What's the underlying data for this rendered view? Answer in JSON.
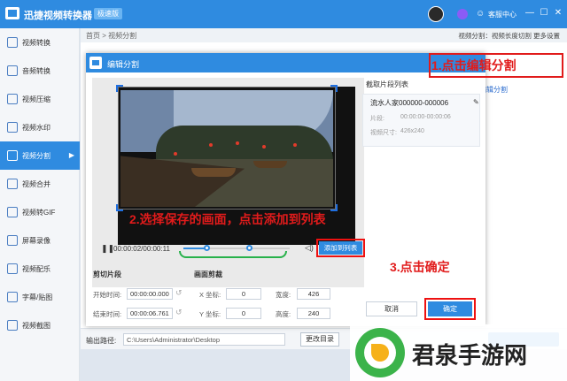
{
  "app": {
    "title": "迅捷视频转换器",
    "edition": "极速版",
    "customer_service": "客服中心",
    "window_buttons": [
      "—",
      "☐",
      "✕"
    ]
  },
  "sidebar": {
    "items": [
      {
        "label": "视频转换",
        "icon": "video-convert-icon"
      },
      {
        "label": "音频转换",
        "icon": "audio-convert-icon"
      },
      {
        "label": "视频压缩",
        "icon": "video-compress-icon"
      },
      {
        "label": "视频水印",
        "icon": "video-watermark-icon"
      },
      {
        "label": "视频分割",
        "icon": "video-split-icon",
        "active": true
      },
      {
        "label": "视频合并",
        "icon": "video-merge-icon"
      },
      {
        "label": "视频转GIF",
        "icon": "video-gif-icon"
      },
      {
        "label": "屏幕录像",
        "icon": "screen-record-icon"
      },
      {
        "label": "视频配乐",
        "icon": "video-music-icon"
      },
      {
        "label": "字幕/贴图",
        "icon": "subtitle-icon"
      },
      {
        "label": "视频截图",
        "icon": "video-screenshot-icon"
      }
    ]
  },
  "breadcrumb": "首页 > 视频分割",
  "top_links": "视频分割：视频长度切割 更多设置",
  "main": {
    "edit_split_link": "编辑分割"
  },
  "dialog": {
    "title": "编辑分割",
    "player": {
      "timecode": "00:00:02/00:00:11",
      "progress": 0.22,
      "handles": [
        0.22,
        0.62
      ],
      "add_to_list": "添加到列表"
    },
    "cut_section": {
      "title": "剪切片段",
      "start_label": "开始时间:",
      "start_value": "00:00:00.000",
      "end_label": "结束时间:",
      "end_value": "00:00:06.761"
    },
    "crop_section": {
      "title": "画面剪裁",
      "x_label": "X 坐标:",
      "x_value": "0",
      "y_label": "Y 坐标:",
      "y_value": "0",
      "width_label": "宽度:",
      "width_value": "426",
      "height_label": "高度:",
      "height_value": "240"
    },
    "clip_list": {
      "title": "截取片段列表",
      "clips": [
        {
          "name": "流水人家000000-000006",
          "segment_label": "片段:",
          "segment_value": "00:00:00-00:00:06",
          "size_label": "视频尺寸:",
          "size_value": "426x240"
        }
      ]
    },
    "cancel": "取消",
    "confirm": "确定"
  },
  "output": {
    "label": "输出路径:",
    "path": "C:\\Users\\Administrator\\Desktop",
    "change_dir": "更改目录"
  },
  "annotations": {
    "step1": "1.点击编辑分割",
    "step2": "2.选择保存的画面，点击添加到列表",
    "step3": "3.点击确定"
  },
  "watermark": {
    "text": "君泉手游网"
  },
  "colors": {
    "primary": "#2f8be0",
    "annotation": "#e11b1b"
  }
}
